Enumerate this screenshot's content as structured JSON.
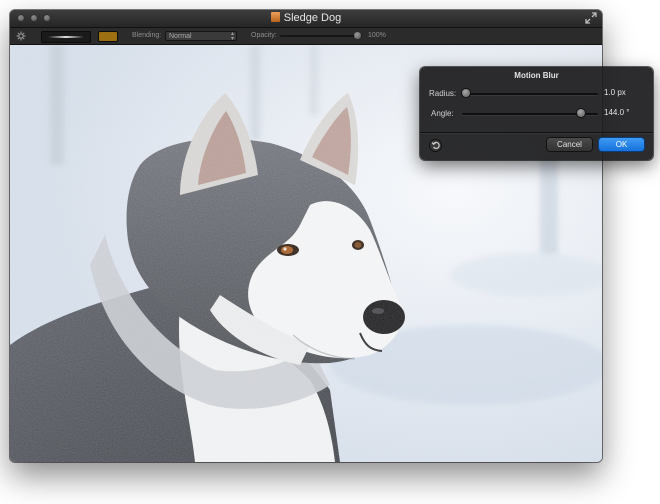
{
  "window": {
    "title": "Sledge Dog"
  },
  "toolbar": {
    "blending_label": "Blending:",
    "blending_value": "Normal",
    "opacity_label": "Opacity:",
    "opacity_value": "100%",
    "opacity_level_percent": 100,
    "color_swatch": "#9c7012"
  },
  "canvas": {
    "image_subject": "husky-photo"
  },
  "motion_blur_panel": {
    "title": "Motion Blur",
    "radius_label": "Radius:",
    "radius_value": "1.0 px",
    "radius_slider_fraction": 0.0,
    "angle_label": "Angle:",
    "angle_value": "144.0 °",
    "angle_slider_fraction": 0.9,
    "cancel_label": "Cancel",
    "ok_label": "OK",
    "ok_color": "#1f7fe6"
  },
  "icons": {
    "close": "circle",
    "minimize": "circle",
    "zoom": "circle",
    "fullscreen": "fullscreen-arrows-icon",
    "settings": "gear-icon",
    "reset": "undo-arrow-icon"
  }
}
